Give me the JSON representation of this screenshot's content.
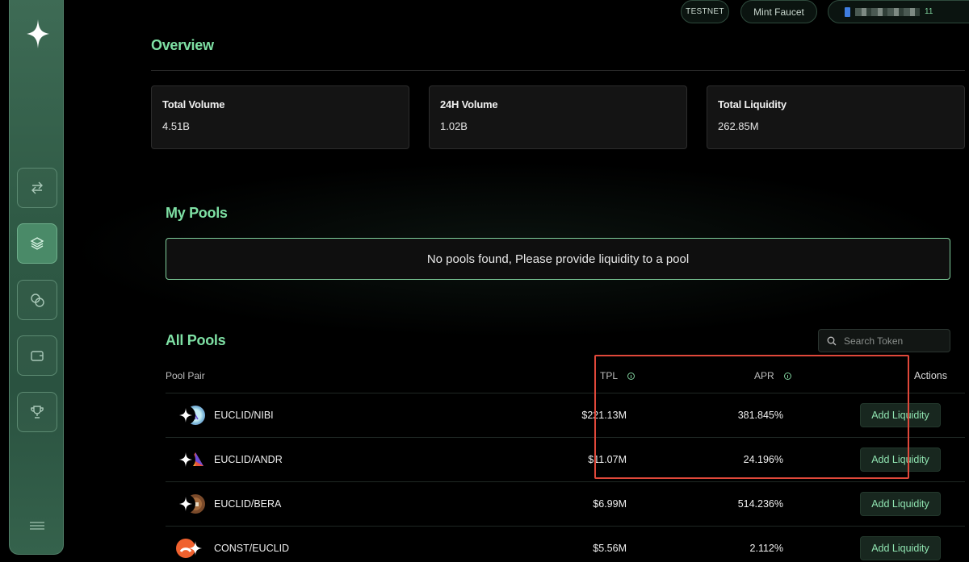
{
  "topbar": {
    "testnet_label": "TESTNET",
    "faucet_label": "Mint Faucet",
    "wallet_suffix": "11"
  },
  "sidebar": {
    "items": [
      {
        "icon": "swap-icon"
      },
      {
        "icon": "layers-icon",
        "active": true
      },
      {
        "icon": "coins-icon"
      },
      {
        "icon": "wallet-icon"
      },
      {
        "icon": "trophy-icon"
      }
    ]
  },
  "overview": {
    "title": "Overview",
    "stats": [
      {
        "label": "Total Volume",
        "value": "4.51B"
      },
      {
        "label": "24H Volume",
        "value": "1.02B"
      },
      {
        "label": "Total Liquidity",
        "value": "262.85M"
      }
    ]
  },
  "my_pools": {
    "title": "My Pools",
    "empty_message": "No pools found, Please provide liquidity to a pool"
  },
  "all_pools": {
    "title": "All Pools",
    "search_placeholder": "Search Token",
    "columns": {
      "pair": "Pool Pair",
      "tpl": "TPL",
      "apr": "APR",
      "actions": "Actions"
    },
    "rows": [
      {
        "pair": "EUCLID/NIBI",
        "tpl": "$221.13M",
        "apr": "381.845%",
        "action": "Add Liquidity"
      },
      {
        "pair": "EUCLID/ANDR",
        "tpl": "$11.07M",
        "apr": "24.196%",
        "action": "Add Liquidity"
      },
      {
        "pair": "EUCLID/BERA",
        "tpl": "$6.99M",
        "apr": "514.236%",
        "action": "Add Liquidity"
      },
      {
        "pair": "CONST/EUCLID",
        "tpl": "$5.56M",
        "apr": "2.112%",
        "action": "Add Liquidity"
      }
    ]
  },
  "colors": {
    "accent": "#7ee0a4",
    "highlight": "#e0483a",
    "sidebar": "#3e6b55"
  }
}
